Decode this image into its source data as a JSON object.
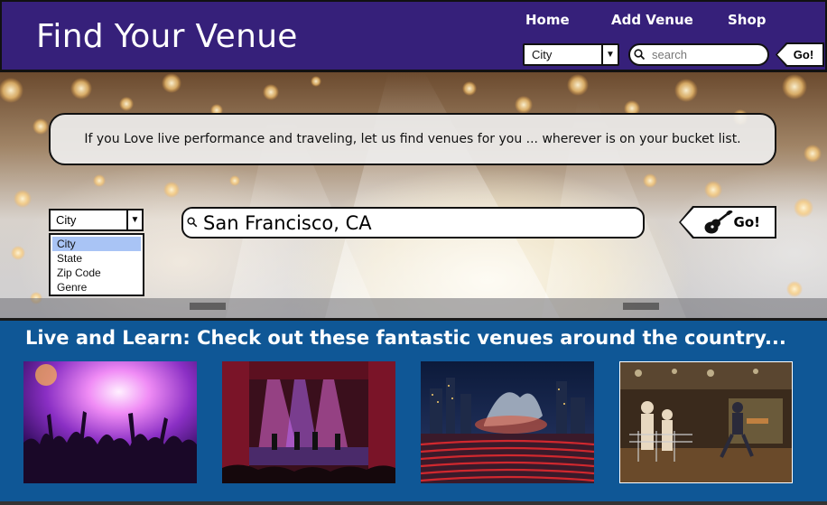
{
  "header": {
    "brand": "Find Your Venue",
    "nav": [
      "Home",
      "Add Venue",
      "Shop"
    ],
    "filter_selected": "City",
    "search_placeholder": "search",
    "go_label": "Go!"
  },
  "hero": {
    "info_text": "If you Love live performance and traveling, let us find venues for you ... wherever is on your bucket list.",
    "filter_selected": "City",
    "filter_options": [
      "City",
      "State",
      "Zip Code",
      "Genre"
    ],
    "search_value": "San Francisco, CA",
    "go_label": "Go!"
  },
  "venues": {
    "title": "Live and Learn: Check out these fantastic venues around the country..."
  },
  "colors": {
    "header_bg": "#36207a",
    "band_bg": "#0f5796",
    "dropdown_highlight": "#a9c4f5"
  },
  "icons": [
    "search-icon",
    "chevron-down-icon",
    "guitar-icon"
  ]
}
